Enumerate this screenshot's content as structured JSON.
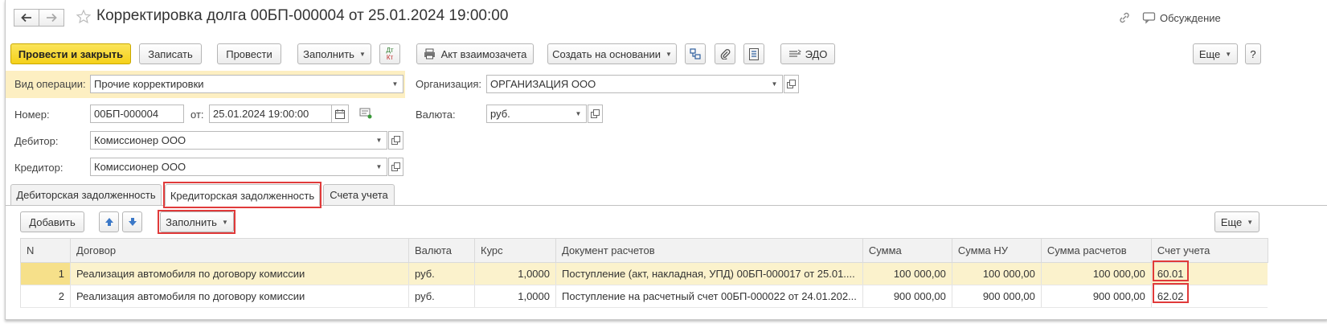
{
  "window": {
    "title": "Корректировка долга 00БП-000004 от 25.01.2024 19:00:00",
    "discussion_label": "Обсуждение"
  },
  "toolbar": {
    "post_close": "Провести и закрыть",
    "write": "Записать",
    "post": "Провести",
    "fill": "Заполнить",
    "dtkt_top": "Дт",
    "dtkt_bottom": "Кт",
    "act_netting": "Акт взаимозачета",
    "create_based": "Создать на основании",
    "edo": "ЭДО",
    "more": "Еще",
    "help": "?"
  },
  "form": {
    "operation_type_label": "Вид операции:",
    "operation_type_value": "Прочие корректировки",
    "organization_label": "Организация:",
    "organization_value": "ОРГАНИЗАЦИЯ ООО",
    "number_label": "Номер:",
    "number_value": "00БП-000004",
    "date_label": "от:",
    "date_value": "25.01.2024 19:00:00",
    "currency_label": "Валюта:",
    "currency_value": "руб.",
    "debtor_label": "Дебитор:",
    "debtor_value": "Комиссионер ООО",
    "creditor_label": "Кредитор:",
    "creditor_value": "Комиссионер ООО"
  },
  "tabs": [
    {
      "label": "Дебиторская задолженность"
    },
    {
      "label": "Кредиторская задолженность"
    },
    {
      "label": "Счета учета"
    }
  ],
  "table_toolbar": {
    "add": "Добавить",
    "fill": "Заполнить",
    "more": "Еще"
  },
  "table": {
    "columns": [
      "N",
      "Договор",
      "Валюта",
      "Курс",
      "Документ расчетов",
      "Сумма",
      "Сумма НУ",
      "Сумма расчетов",
      "Счет учета"
    ],
    "rows": [
      {
        "n": "1",
        "contract": "Реализация автомобиля по договору комиссии",
        "currency": "руб.",
        "rate": "1,0000",
        "document": "Поступление (акт, накладная, УПД) 00БП-000017 от 25.01....",
        "sum": "100 000,00",
        "sum_nu": "100 000,00",
        "sum_settlement": "100 000,00",
        "account": "60.01"
      },
      {
        "n": "2",
        "contract": "Реализация автомобиля по договору комиссии",
        "currency": "руб.",
        "rate": "1,0000",
        "document": "Поступление на расчетный счет 00БП-000022 от 24.01.202...",
        "sum": "900 000,00",
        "sum_nu": "900 000,00",
        "sum_settlement": "900 000,00",
        "account": "62.02"
      }
    ]
  },
  "colors": {
    "primary_button": "#f5d11a",
    "highlight_row": "#fbf2cc",
    "annotation_red": "#e03a3a",
    "operation_strip": "#fdefc2"
  }
}
